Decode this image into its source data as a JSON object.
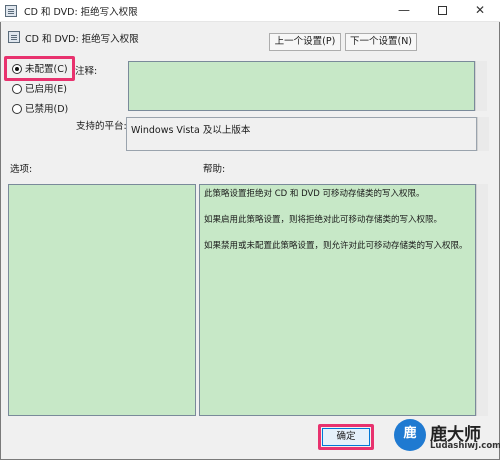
{
  "window": {
    "title": "CD 和 DVD: 拒绝写入权限",
    "minimize_glyph": "—",
    "close_glyph": "✕"
  },
  "header": {
    "setting_title": "CD 和 DVD: 拒绝写入权限",
    "prev_button": "上一个设置(P)",
    "next_button": "下一个设置(N)"
  },
  "state_options": [
    {
      "label": "未配置(C)",
      "selected": true
    },
    {
      "label": "已启用(E)",
      "selected": false
    },
    {
      "label": "已禁用(D)",
      "selected": false
    }
  ],
  "comment": {
    "label": "注释:",
    "value": ""
  },
  "platform": {
    "label": "支持的平台:",
    "value": "Windows Vista 及以上版本"
  },
  "options_pane": {
    "label": "选项:"
  },
  "help_pane": {
    "label": "帮助:",
    "paragraphs": [
      "此策略设置拒绝对 CD 和 DVD 可移动存储类的写入权限。",
      "如果启用此策略设置，则将拒绝对此可移动存储类的写入权限。",
      "如果禁用或未配置此策略设置，则允许对此可移动存储类的写入权限。"
    ]
  },
  "footer": {
    "ok_button": "确定"
  },
  "watermark": {
    "logo_glyph": "鹿",
    "name": "鹿大师",
    "site": "Ludashiwj.com"
  },
  "colors": {
    "field_green": "#c7e8c7",
    "highlight_pink": "#e8326e",
    "watermark_blue": "#1f7ad1"
  }
}
